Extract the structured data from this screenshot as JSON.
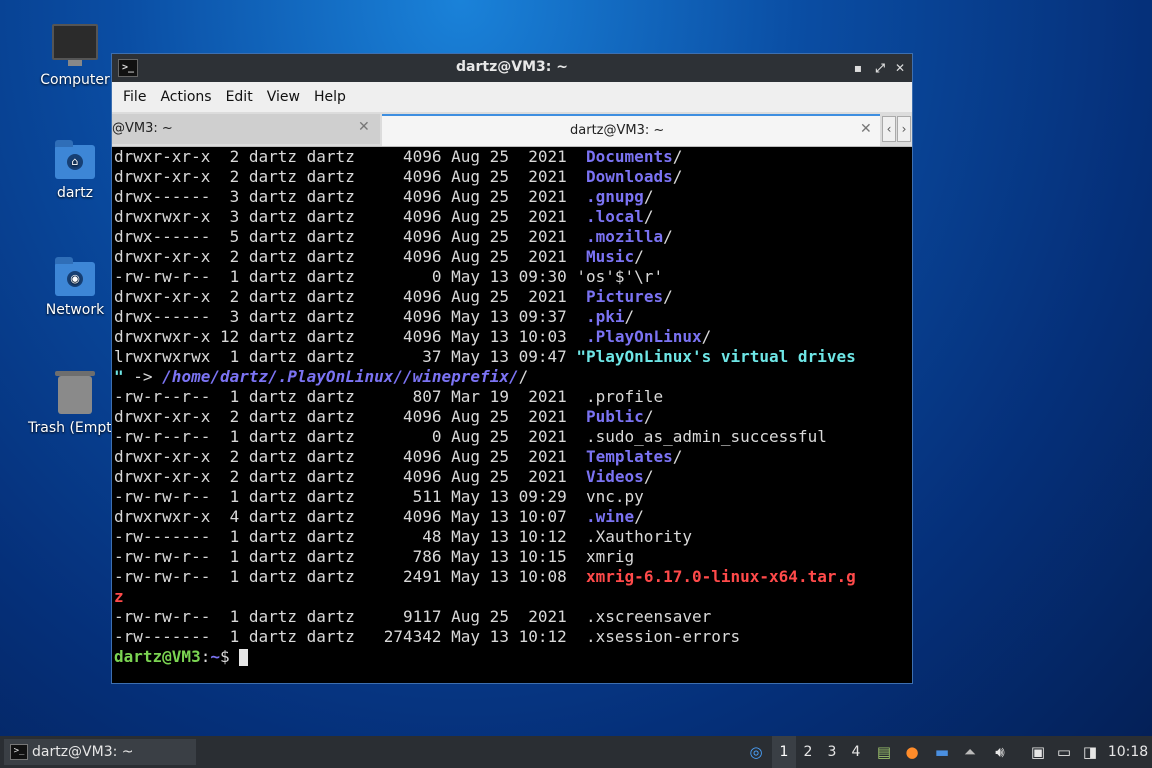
{
  "desktop": {
    "icons": [
      {
        "label": "Computer",
        "icon": "computer-icon"
      },
      {
        "label": "dartz",
        "icon": "home-folder-icon"
      },
      {
        "label": "Network",
        "icon": "network-folder-icon"
      },
      {
        "label": "Trash (Empt",
        "icon": "trash-icon"
      }
    ]
  },
  "window": {
    "title": "dartz@VM3: ~",
    "menu": [
      "File",
      "Actions",
      "Edit",
      "View",
      "Help"
    ],
    "tabs": [
      {
        "label": "@VM3: ~"
      },
      {
        "label": "dartz@VM3: ~"
      }
    ]
  },
  "terminal": {
    "lines": [
      [
        {
          "t": "drwxr-xr-x  2 dartz dartz     4096 Aug 25  2021  "
        },
        {
          "t": "Documents",
          "c": "dir"
        },
        {
          "t": "/"
        }
      ],
      [
        {
          "t": "drwxr-xr-x  2 dartz dartz     4096 Aug 25  2021  "
        },
        {
          "t": "Downloads",
          "c": "dir"
        },
        {
          "t": "/"
        }
      ],
      [
        {
          "t": "drwx------  3 dartz dartz     4096 Aug 25  2021  "
        },
        {
          "t": ".gnupg",
          "c": "dir"
        },
        {
          "t": "/"
        }
      ],
      [
        {
          "t": "drwxrwxr-x  3 dartz dartz     4096 Aug 25  2021  "
        },
        {
          "t": ".local",
          "c": "dir"
        },
        {
          "t": "/"
        }
      ],
      [
        {
          "t": "drwx------  5 dartz dartz     4096 Aug 25  2021  "
        },
        {
          "t": ".mozilla",
          "c": "dir"
        },
        {
          "t": "/"
        }
      ],
      [
        {
          "t": "drwxr-xr-x  2 dartz dartz     4096 Aug 25  2021  "
        },
        {
          "t": "Music",
          "c": "dir"
        },
        {
          "t": "/"
        }
      ],
      [
        {
          "t": "-rw-rw-r--  1 dartz dartz        0 May 13 09:30 'os'$'\\r'"
        }
      ],
      [
        {
          "t": "drwxr-xr-x  2 dartz dartz     4096 Aug 25  2021  "
        },
        {
          "t": "Pictures",
          "c": "dir"
        },
        {
          "t": "/"
        }
      ],
      [
        {
          "t": "drwx------  3 dartz dartz     4096 May 13 09:37  "
        },
        {
          "t": ".pki",
          "c": "dir"
        },
        {
          "t": "/"
        }
      ],
      [
        {
          "t": "drwxrwxr-x 12 dartz dartz     4096 May 13 10:03  "
        },
        {
          "t": ".PlayOnLinux",
          "c": "dir"
        },
        {
          "t": "/"
        }
      ],
      [
        {
          "t": "lrwxrwxrwx  1 dartz dartz       37 May 13 09:47 "
        },
        {
          "t": "\"PlayOnLinux's virtual drives",
          "c": "link"
        }
      ],
      [
        {
          "t": "\"",
          "c": "link"
        },
        {
          "t": " -> "
        },
        {
          "t": "/home/dartz/.PlayOnLinux//wineprefix/",
          "c": "target"
        },
        {
          "t": "/"
        }
      ],
      [
        {
          "t": "-rw-r--r--  1 dartz dartz      807 Mar 19  2021  .profile"
        }
      ],
      [
        {
          "t": "drwxr-xr-x  2 dartz dartz     4096 Aug 25  2021  "
        },
        {
          "t": "Public",
          "c": "dir"
        },
        {
          "t": "/"
        }
      ],
      [
        {
          "t": "-rw-r--r--  1 dartz dartz        0 Aug 25  2021  .sudo_as_admin_successful"
        }
      ],
      [
        {
          "t": "drwxr-xr-x  2 dartz dartz     4096 Aug 25  2021  "
        },
        {
          "t": "Templates",
          "c": "dir"
        },
        {
          "t": "/"
        }
      ],
      [
        {
          "t": "drwxr-xr-x  2 dartz dartz     4096 Aug 25  2021  "
        },
        {
          "t": "Videos",
          "c": "dir"
        },
        {
          "t": "/"
        }
      ],
      [
        {
          "t": "-rw-rw-r--  1 dartz dartz      511 May 13 09:29  vnc.py"
        }
      ],
      [
        {
          "t": "drwxrwxr-x  4 dartz dartz     4096 May 13 10:07  "
        },
        {
          "t": ".wine",
          "c": "dir"
        },
        {
          "t": "/"
        }
      ],
      [
        {
          "t": "-rw-------  1 dartz dartz       48 May 13 10:12  .Xauthority"
        }
      ],
      [
        {
          "t": "-rw-rw-r--  1 dartz dartz      786 May 13 10:15  xmrig"
        }
      ],
      [
        {
          "t": "-rw-rw-r--  1 dartz dartz     2491 May 13 10:08  "
        },
        {
          "t": "xmrig-6.17.0-linux-x64.tar.g",
          "c": "arch"
        }
      ],
      [
        {
          "t": "z",
          "c": "arch"
        }
      ],
      [
        {
          "t": "-rw-rw-r--  1 dartz dartz     9117 Aug 25  2021  .xscreensaver"
        }
      ],
      [
        {
          "t": "-rw-------  1 dartz dartz   274342 May 13 10:12  .xsession-errors"
        }
      ]
    ],
    "prompt_user": "dartz@VM3",
    "prompt_colon": ":",
    "prompt_path": "~",
    "prompt_symbol": "$ "
  },
  "taskbar": {
    "task_label": "dartz@VM3: ~",
    "workspaces": [
      "1",
      "2",
      "3",
      "4"
    ],
    "active_workspace": "1",
    "clock": "10:18"
  }
}
